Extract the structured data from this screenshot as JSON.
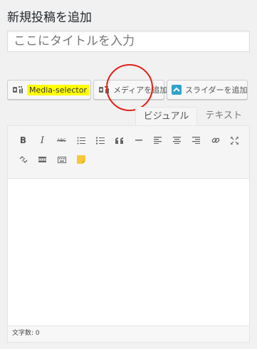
{
  "page": {
    "title": "新規投稿を追加"
  },
  "title_field": {
    "placeholder": "ここにタイトルを入力"
  },
  "media_buttons": {
    "media_selector_label": "Media-selector",
    "add_media_label": "メディアを追加",
    "add_slider_label": "スライダーを追加"
  },
  "editor_tabs": {
    "visual": "ビジュアル",
    "text": "テキスト"
  },
  "toolbar": {
    "row1": [
      "bold",
      "italic",
      "strikethrough",
      "bullet-list",
      "numbered-list",
      "blockquote",
      "horizontal-line",
      "align-left",
      "align-center",
      "align-right",
      "link",
      "fullscreen"
    ],
    "row2": [
      "unlink",
      "read-more",
      "toolbar-toggle",
      "sticky-note"
    ],
    "bold_label": "B",
    "italic_label": "I",
    "strike_label": "ABC"
  },
  "status": {
    "word_count": "文字数: 0"
  },
  "colors": {
    "highlight": "#ffff00",
    "annotation_circle": "#e2231a",
    "slider_icon": "#2ea2cc"
  }
}
